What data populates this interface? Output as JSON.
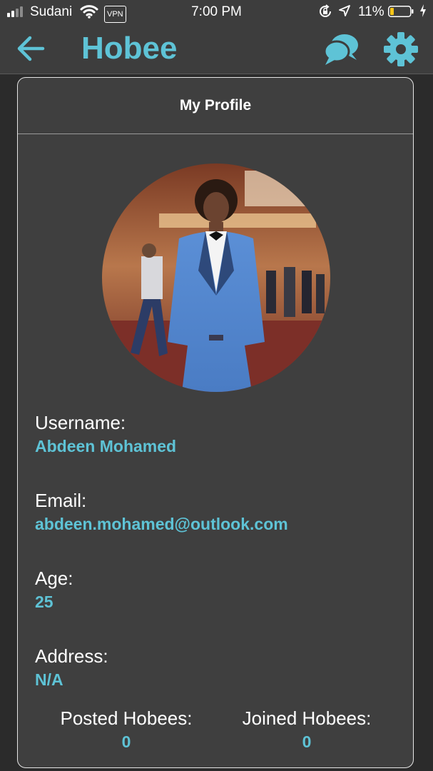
{
  "status_bar": {
    "carrier": "Sudani",
    "vpn": "VPN",
    "time": "7:00 PM",
    "battery": "11%",
    "icons": [
      "signal-icon",
      "wifi-icon",
      "rotation-lock-icon",
      "location-arrow-icon",
      "battery-icon",
      "charging-bolt-icon"
    ]
  },
  "header": {
    "title": "Hobee",
    "icons": [
      "back-arrow-icon",
      "chat-bubbles-icon",
      "gear-icon"
    ]
  },
  "profile": {
    "title": "My Profile",
    "avatar": "profile-photo",
    "fields": {
      "username_label": "Username:",
      "username": "Abdeen Mohamed",
      "email_label": "Email:",
      "email": "abdeen.mohamed@outlook.com",
      "age_label": "Age:",
      "age": "25",
      "address_label": "Address:",
      "address": "N/A"
    },
    "stats": {
      "posted_label": "Posted Hobees:",
      "posted": "0",
      "joined_label": "Joined Hobees:",
      "joined": "0"
    }
  },
  "colors": {
    "accent": "#5ec3d6",
    "bar": "#3d3d3d",
    "card": "#3f3f3f",
    "battery_low": "#f5c518"
  }
}
